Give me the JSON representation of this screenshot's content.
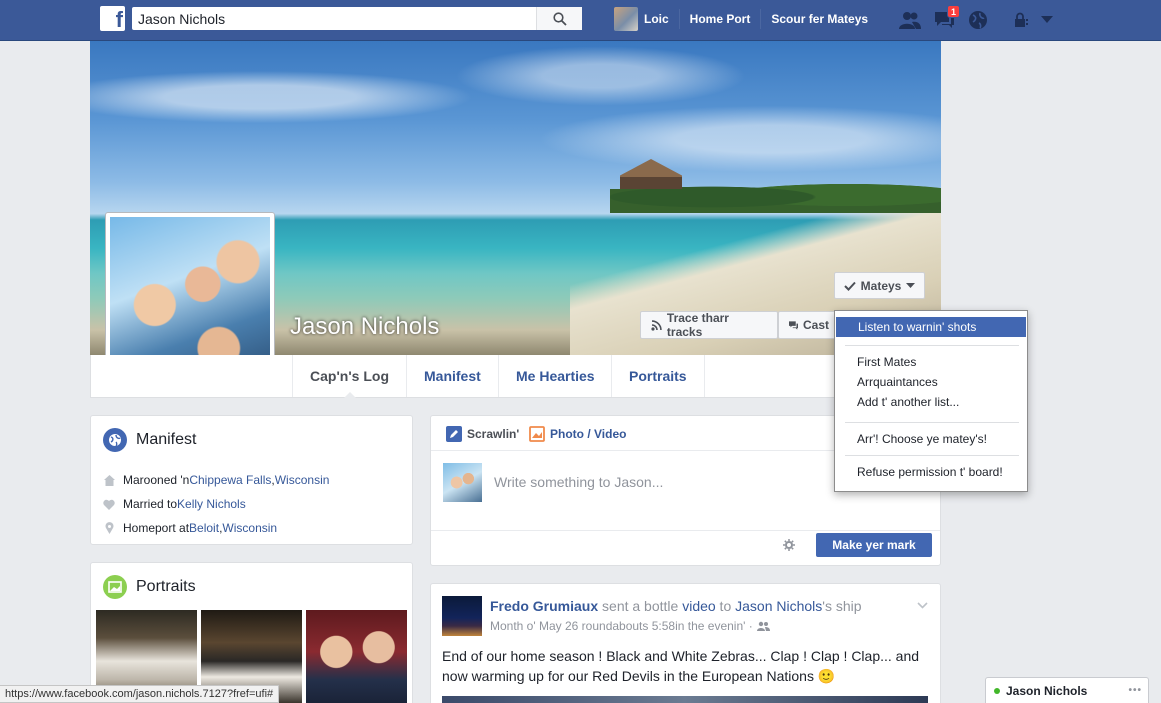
{
  "header": {
    "logo": "f",
    "search_value": "Jason Nichols",
    "nav": [
      "Loic",
      "Home Port",
      "Scour fer Mateys"
    ],
    "notification_count": "1"
  },
  "profile": {
    "name": "Jason Nichols",
    "buttons": {
      "follow": "Trace tharr tracks",
      "message": "Cast",
      "friends": "Mateys"
    },
    "tabs": [
      "Cap'n's Log",
      "Manifest",
      "Me Hearties",
      "Portraits"
    ]
  },
  "friends_menu": {
    "items": [
      "Listen to warnin' shots",
      "First Mates",
      "Arrquaintances",
      "Add t' another list...",
      "Arr'! Choose ye matey's!",
      "Refuse permission t' board!"
    ]
  },
  "intro": {
    "title": "Manifest",
    "rows": [
      {
        "prefix": "Marooned 'n ",
        "link1": "Chippewa Falls",
        "sep": ", ",
        "link2": "Wisconsin"
      },
      {
        "prefix": "Married to ",
        "link1": "Kelly Nichols"
      },
      {
        "prefix": "Homeport at ",
        "link1": "Beloit",
        "sep": ", ",
        "link2": "Wisconsin"
      }
    ]
  },
  "photos": {
    "title": "Portraits"
  },
  "composer": {
    "tab_status": "Scrawlin'",
    "tab_photo": "Photo / Video",
    "placeholder": "Write something to Jason...",
    "post_button": "Make yer mark"
  },
  "post": {
    "author": "Fredo Grumiaux",
    "action": " sent a bottle ",
    "object": "video",
    "to": " to ",
    "target": "Jason Nichols",
    "suffix": "'s ship",
    "meta": "Month o' May 26 roundabouts 5:58in the evenin' ·",
    "text": "End of our home season ! Black and White Zebras... Clap ! Clap ! Clap... and now warming up for our Red Devils in the European Nations 🙂"
  },
  "status_bar": {
    "url": "https://www.facebook.com/jason.nichols.7127?fref=ufi#"
  },
  "chat": {
    "name": "Jason Nichols",
    "more": "•••"
  },
  "colors": {
    "brand": "#3b5998",
    "button": "#4267b2",
    "link": "#365899"
  }
}
